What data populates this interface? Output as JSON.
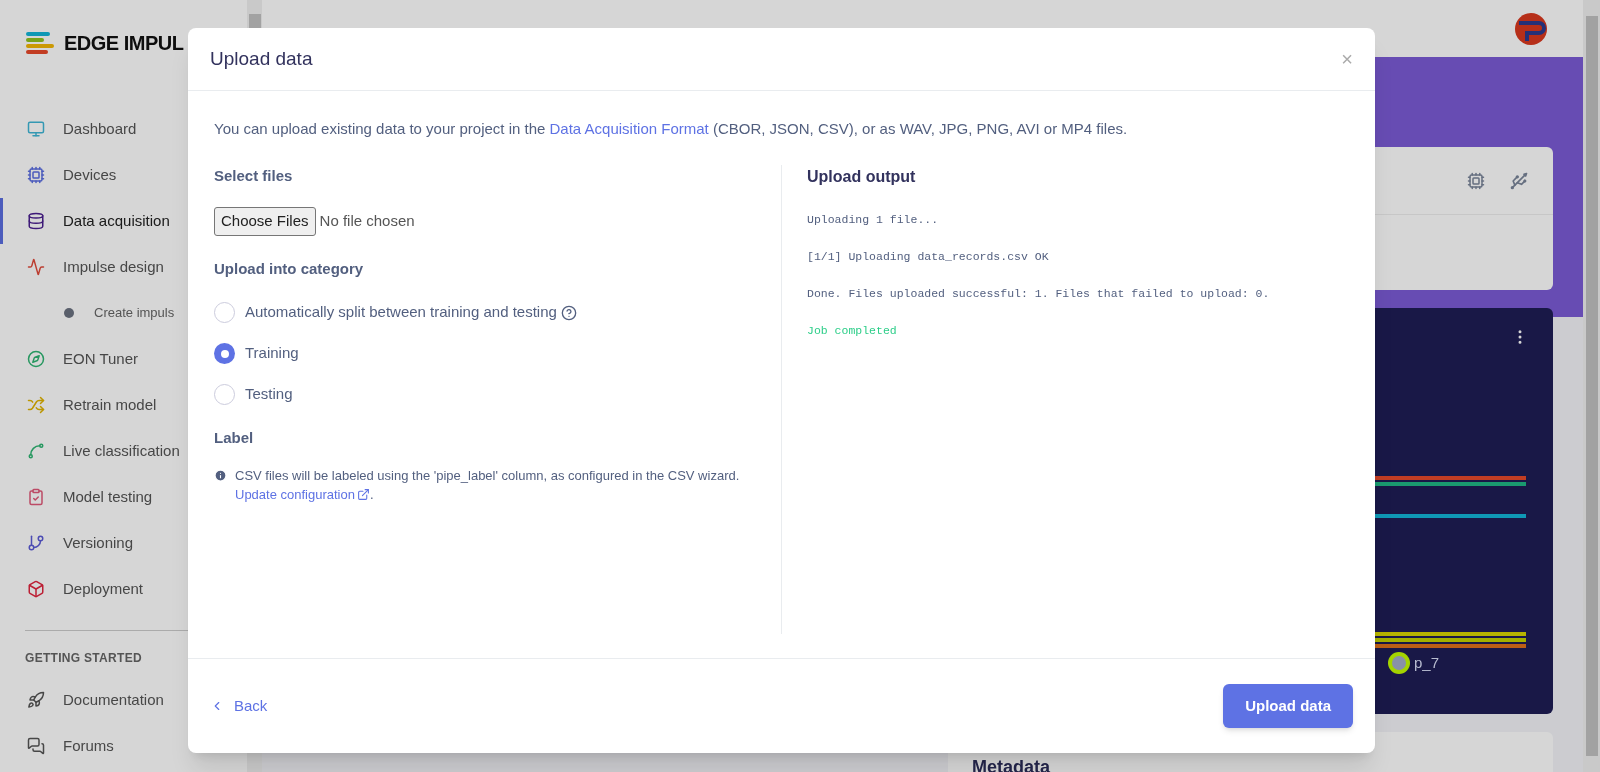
{
  "sidebar": {
    "logo_text": "EDGE IMPUL",
    "items": [
      {
        "label": "Dashboard",
        "selected": false
      },
      {
        "label": "Devices",
        "selected": false
      },
      {
        "label": "Data acquisition",
        "selected": true
      },
      {
        "label": "Impulse design",
        "selected": false,
        "children": [
          {
            "label": "Create impuls",
            "selected": false
          }
        ]
      },
      {
        "label": "EON Tuner",
        "selected": false
      },
      {
        "label": "Retrain model",
        "selected": false
      },
      {
        "label": "Live classification",
        "selected": false
      },
      {
        "label": "Model testing",
        "selected": false
      },
      {
        "label": "Versioning",
        "selected": false
      },
      {
        "label": "Deployment",
        "selected": false
      }
    ],
    "section_title": "GETTING STARTED",
    "section_items": [
      {
        "label": "Documentation"
      },
      {
        "label": "Forums"
      }
    ]
  },
  "background": {
    "legend": [
      {
        "label": "p_7",
        "color": "#a4d400"
      }
    ],
    "metadata_title": "Metadata"
  },
  "dialog": {
    "title": "Upload data",
    "close": "×",
    "intro": {
      "before": "You can upload existing data to your project in the ",
      "link": "Data Acquisition Format",
      "after": " (CBOR, JSON, CSV), or as WAV, JPG, PNG, AVI or MP4 files."
    },
    "select_files_title": "Select files",
    "choose_button": "Choose Files",
    "no_file": "No file chosen",
    "category_title": "Upload into category",
    "categories": [
      {
        "label": "Automatically split between training and testing",
        "selected": false,
        "help": true
      },
      {
        "label": "Training",
        "selected": true,
        "help": false
      },
      {
        "label": "Testing",
        "selected": false,
        "help": false
      }
    ],
    "label_title": "Label",
    "label_note": "CSV files will be labeled using the 'pipe_label' column, as configured in the CSV wizard.",
    "label_link": "Update configuration",
    "label_after": ".",
    "output_title": "Upload output",
    "output_lines": [
      {
        "text": "Uploading 1 file...",
        "kind": "info"
      },
      {
        "text": "[1/1] Uploading data_records.csv OK",
        "kind": "info"
      },
      {
        "text": "Done. Files uploaded successful: 1. Files that failed to upload: 0.",
        "kind": "info"
      },
      {
        "text": "Job completed",
        "kind": "success"
      }
    ],
    "back": "Back",
    "submit": "Upload data"
  }
}
